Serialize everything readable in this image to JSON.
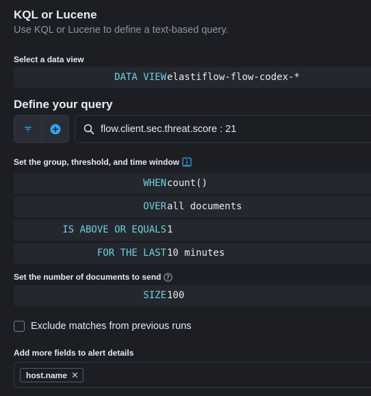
{
  "header": {
    "title": "KQL or Lucene",
    "subtitle": "Use KQL or Lucene to define a text-based query."
  },
  "data_view": {
    "label": "Select a data view",
    "keyword": "DATA VIEW",
    "value": "elastiflow-flow-codex-*"
  },
  "query": {
    "title": "Define your query",
    "filter_icon": "filter-icon",
    "add_icon": "plus-circle-icon",
    "search_icon": "search-icon",
    "text": "flow.client.sec.threat.score : 21"
  },
  "threshold": {
    "label": "Set the group, threshold, and time window",
    "info_icon": "book-icon",
    "rows": [
      {
        "keyword": "WHEN",
        "value": "count()"
      },
      {
        "keyword": "OVER",
        "value": "all documents"
      },
      {
        "keyword": "IS ABOVE OR EQUALS",
        "value": "1"
      },
      {
        "keyword": "FOR THE LAST",
        "value": "10 minutes"
      }
    ]
  },
  "size": {
    "label": "Set the number of documents to send",
    "help_icon": "question-circle-icon",
    "keyword": "SIZE",
    "value": "100"
  },
  "exclude": {
    "label": "Exclude matches from previous runs",
    "checked": false
  },
  "fields": {
    "label": "Add more fields to alert details",
    "items": [
      {
        "label": "host.name",
        "remove": "✕"
      }
    ]
  },
  "colors": {
    "background": "#1d1e24",
    "keyword": "#6fd0de",
    "accent": "#36a2ef"
  }
}
